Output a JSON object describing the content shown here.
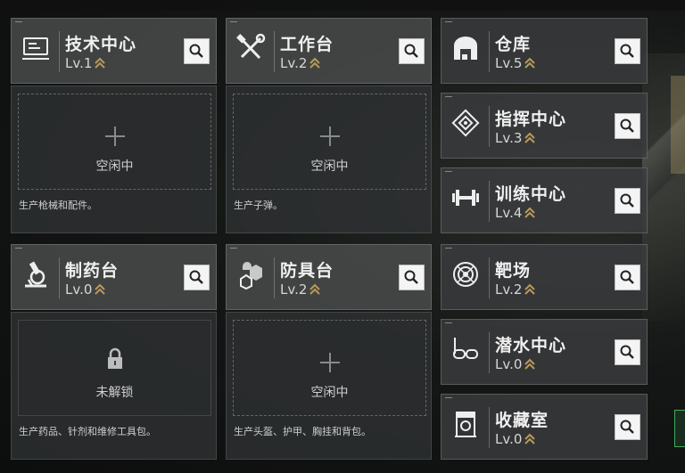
{
  "facilities": {
    "tech_center": {
      "name": "技术中心",
      "level": "Lv.1",
      "icon": "computer-icon",
      "status": "空闲中",
      "desc": "生产枪械和配件。"
    },
    "workbench": {
      "name": "工作台",
      "level": "Lv.2",
      "icon": "tools-icon",
      "status": "空闲中",
      "desc": "生产子弹。"
    },
    "pharmacy": {
      "name": "制药台",
      "level": "Lv.0",
      "icon": "microscope-icon",
      "status": "未解锁",
      "desc": "生产药品、针剂和维修工具包。"
    },
    "armor_bench": {
      "name": "防具台",
      "level": "Lv.2",
      "icon": "armor-icon",
      "status": "空闲中",
      "desc": "生产头盔、护甲、胸挂和背包。"
    },
    "warehouse": {
      "name": "仓库",
      "level": "Lv.5",
      "icon": "warehouse-icon"
    },
    "command_center": {
      "name": "指挥中心",
      "level": "Lv.3",
      "icon": "command-icon"
    },
    "training_center": {
      "name": "训练中心",
      "level": "Lv.4",
      "icon": "dumbbell-icon"
    },
    "shooting_range": {
      "name": "靶场",
      "level": "Lv.2",
      "icon": "target-icon"
    },
    "diving_center": {
      "name": "潜水中心",
      "level": "Lv.0",
      "icon": "diving-mask-icon"
    },
    "collection_room": {
      "name": "收藏室",
      "level": "Lv.0",
      "icon": "collection-icon"
    }
  },
  "colors": {
    "chevron": "#b89a5a",
    "card_bg": "#3a3c3e",
    "search_bg": "#f4f4f4"
  }
}
